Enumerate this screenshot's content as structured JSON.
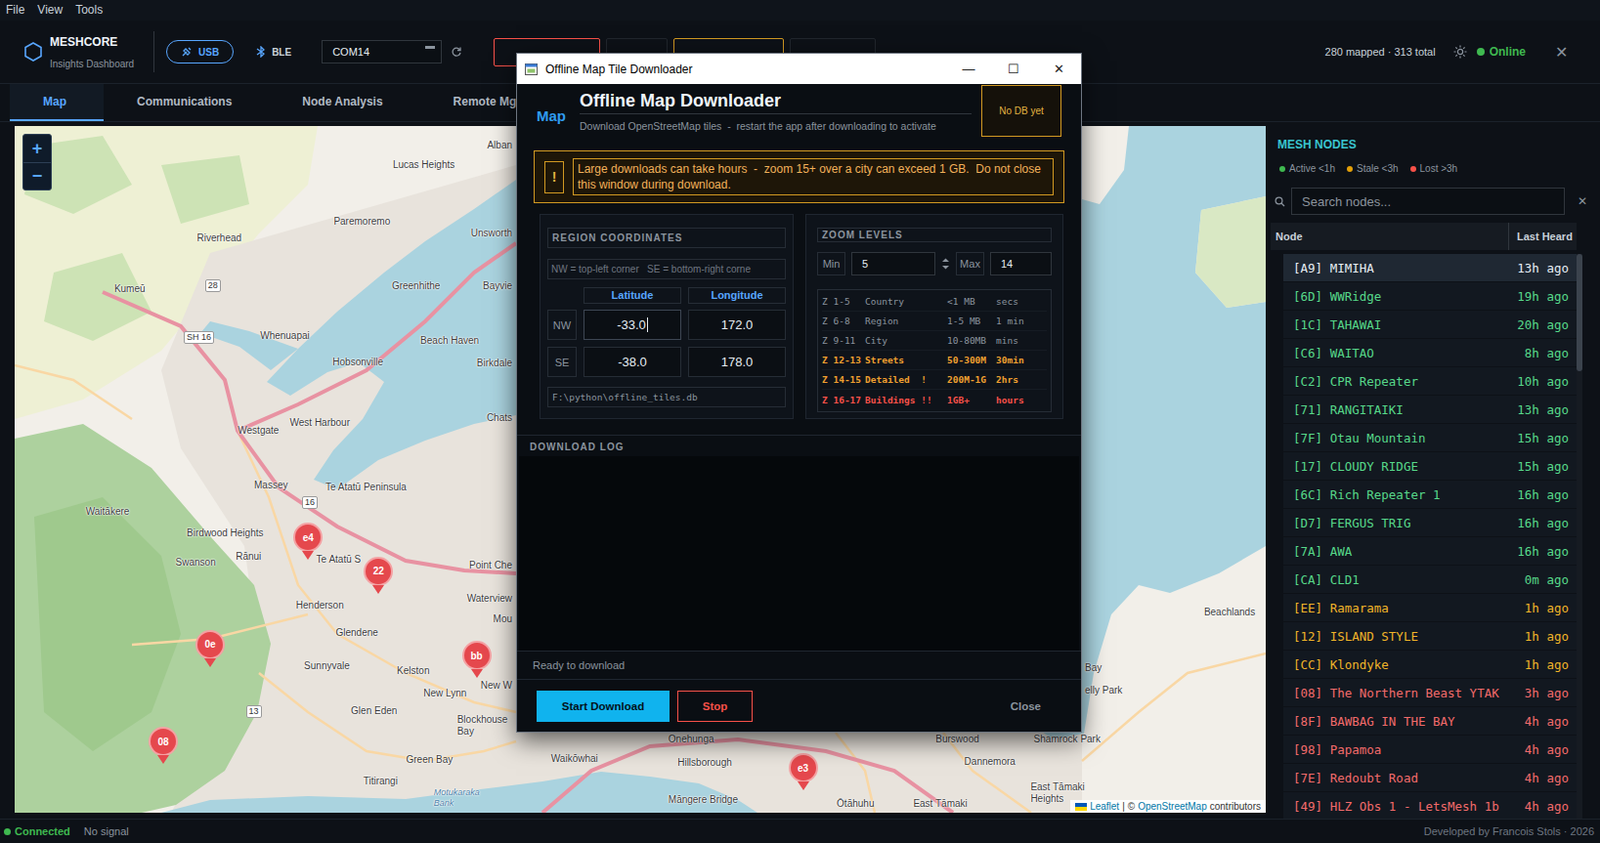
{
  "menu": [
    {
      "label": "File"
    },
    {
      "label": "View"
    },
    {
      "label": "Tools"
    }
  ],
  "header": {
    "logo": {
      "title": "MESHCORE",
      "subtitle": "Insights Dashboard"
    },
    "connection": [
      {
        "label": "USB",
        "selected": true
      },
      {
        "label": "BLE",
        "selected": false
      }
    ],
    "port": "COM14",
    "stats": "280 mapped · 313 total",
    "status": {
      "label": "Online",
      "online": true
    },
    "close": "✕"
  },
  "tabs": [
    {
      "label": "Map",
      "selected": true
    },
    {
      "label": "Communications",
      "selected": false
    },
    {
      "label": "Node Analysis",
      "selected": false
    },
    {
      "label": "Remote Mgr",
      "selected": false
    }
  ],
  "map": {
    "zoom": [
      {
        "label": "+"
      },
      {
        "label": "−"
      }
    ],
    "labels": [
      {
        "text": "Lucas Heights",
        "kind": "place"
      },
      {
        "text": "Alban",
        "kind": "place"
      },
      {
        "text": "Paremoremo",
        "kind": "place"
      },
      {
        "text": "Riverhead",
        "kind": "place"
      },
      {
        "text": "Unsworth",
        "kind": "place"
      },
      {
        "text": "Kumeū",
        "kind": "place"
      },
      {
        "text": "28",
        "kind": "shield"
      },
      {
        "text": "Greenhithe",
        "kind": "place"
      },
      {
        "text": "Bayvie",
        "kind": "place"
      },
      {
        "text": "SH 16",
        "kind": "shield"
      },
      {
        "text": "Whenuapai",
        "kind": "place"
      },
      {
        "text": "Beach Haven",
        "kind": "place"
      },
      {
        "text": "Hobsonville",
        "kind": "place"
      },
      {
        "text": "Birkdale",
        "kind": "place"
      },
      {
        "text": "West Harbour",
        "kind": "place"
      },
      {
        "text": "Chats",
        "kind": "place"
      },
      {
        "text": "Westgate",
        "kind": "place"
      },
      {
        "text": "Massey",
        "kind": "place"
      },
      {
        "text": "Te Atatū Peninsula",
        "kind": "place"
      },
      {
        "text": "16",
        "kind": "shield"
      },
      {
        "text": "Waitākere",
        "kind": "place"
      },
      {
        "text": "Birdwood Heights",
        "kind": "place"
      },
      {
        "text": "Swanson",
        "kind": "place"
      },
      {
        "text": "Rānui",
        "kind": "place"
      },
      {
        "text": "Te Atatū S",
        "kind": "place"
      },
      {
        "text": "Point Che",
        "kind": "place"
      },
      {
        "text": "Henderson",
        "kind": "place"
      },
      {
        "text": "Waterview",
        "kind": "place"
      },
      {
        "text": "Mou",
        "kind": "place"
      },
      {
        "text": "Glendene",
        "kind": "place"
      },
      {
        "text": "Sunnyvale",
        "kind": "place"
      },
      {
        "text": "Kelston",
        "kind": "place"
      },
      {
        "text": "New W",
        "kind": "place"
      },
      {
        "text": "New Lynn",
        "kind": "place"
      },
      {
        "text": "13",
        "kind": "shield"
      },
      {
        "text": "Glen Eden",
        "kind": "place"
      },
      {
        "text": "Blockhouse Bay",
        "kind": "place"
      },
      {
        "text": "Green Bay",
        "kind": "place"
      },
      {
        "text": "Waikōwhai",
        "kind": "place"
      },
      {
        "text": "Titirangi",
        "kind": "place"
      },
      {
        "text": "Onehunga",
        "kind": "place"
      },
      {
        "text": "Hillsborough",
        "kind": "place"
      },
      {
        "text": "Motukaraka Bank",
        "kind": "water"
      },
      {
        "text": "Māngere Bridge",
        "kind": "place"
      },
      {
        "text": "Ōtāhuhu",
        "kind": "place"
      },
      {
        "text": "Burswood",
        "kind": "place"
      },
      {
        "text": "Dannemora",
        "kind": "place"
      },
      {
        "text": "Shamrock Park",
        "kind": "place"
      },
      {
        "text": "East Tāmaki",
        "kind": "place"
      },
      {
        "text": "East Tāmaki Heights",
        "kind": "place"
      },
      {
        "text": "Bay",
        "kind": "place"
      },
      {
        "text": "elly Park",
        "kind": "place"
      },
      {
        "text": "Beachlands",
        "kind": "place"
      }
    ],
    "pins": [
      {
        "label": "e4"
      },
      {
        "label": "22"
      },
      {
        "label": "0e"
      },
      {
        "label": "bb"
      },
      {
        "label": "08"
      },
      {
        "label": "e3"
      }
    ],
    "attribution": {
      "leaflet": "Leaflet",
      "separator": "|",
      "copyright": "©",
      "osm": "OpenStreetMap",
      "contributors": "contributors"
    }
  },
  "sidebar": {
    "title": "MESH NODES",
    "legend": [
      {
        "label": "Active <1h",
        "color": "#3fb950"
      },
      {
        "label": "Stale <3h",
        "color": "#e3a008"
      },
      {
        "label": "Lost >3h",
        "color": "#f85149"
      }
    ],
    "search": {
      "placeholder": "Search nodes...",
      "clear": "✕"
    },
    "columns": [
      "Node",
      "Last Heard"
    ],
    "nodes": [
      {
        "name": "[A9] MIMIHA",
        "last": "13h ago",
        "color": "#e6edf3",
        "selected": true
      },
      {
        "name": "[6D] WWRidge",
        "last": "19h ago",
        "color": "#57d98a",
        "selected": false
      },
      {
        "name": "[1C] TAHAWAI",
        "last": "20h ago",
        "color": "#57d98a",
        "selected": false
      },
      {
        "name": "[C6] WAITAO",
        "last": "8h ago",
        "color": "#57d98a",
        "selected": false
      },
      {
        "name": "[C2] CPR Repeater",
        "last": "10h ago",
        "color": "#57d98a",
        "selected": false
      },
      {
        "name": "[71] RANGITAIKI",
        "last": "13h ago",
        "color": "#57d98a",
        "selected": false
      },
      {
        "name": "[7F] Otau Mountain",
        "last": "15h ago",
        "color": "#57d98a",
        "selected": false
      },
      {
        "name": "[17] CLOUDY RIDGE",
        "last": "15h ago",
        "color": "#57d98a",
        "selected": false
      },
      {
        "name": "[6C] Rich Repeater 1",
        "last": "16h ago",
        "color": "#57d98a",
        "selected": false
      },
      {
        "name": "[D7] FERGUS TRIG",
        "last": "16h ago",
        "color": "#57d98a",
        "selected": false
      },
      {
        "name": "[7A] AWA",
        "last": "16h ago",
        "color": "#57d98a",
        "selected": false
      },
      {
        "name": "[CA] CLD1",
        "last": "0m ago",
        "color": "#57d98a",
        "selected": false
      },
      {
        "name": "[EE] Ramarama",
        "last": "1h ago",
        "color": "#f0b429",
        "selected": false
      },
      {
        "name": "[12] ISLAND STYLE",
        "last": "1h ago",
        "color": "#f0b429",
        "selected": false
      },
      {
        "name": "[CC] Klondyke",
        "last": "1h ago",
        "color": "#f0b429",
        "selected": false
      },
      {
        "name": "[08] The Northern Beast YTAK",
        "last": "3h ago",
        "color": "#f26b6b",
        "selected": false
      },
      {
        "name": "[8F] BAWBAG IN THE BAY",
        "last": "4h ago",
        "color": "#f26b6b",
        "selected": false
      },
      {
        "name": "[98] Papamoa",
        "last": "4h ago",
        "color": "#f26b6b",
        "selected": false
      },
      {
        "name": "[7E] Redoubt Road",
        "last": "4h ago",
        "color": "#f26b6b",
        "selected": false
      },
      {
        "name": "[49] HLZ Obs 1 - LetsMesh 1b",
        "last": "4h ago",
        "color": "#f26b6b",
        "selected": false
      }
    ]
  },
  "dialog": {
    "title": "Offline Map Tile Downloader",
    "controls": [
      "—",
      "☐",
      "✕"
    ],
    "brand": "Map",
    "heading": "Offline Map Downloader",
    "subtitle": "Download OpenStreetMap tiles  -  restart the app after downloading to activate",
    "badge": "No DB yet",
    "warning": {
      "icon": "!",
      "text": "Large downloads can take hours  -  zoom 15+ over a city can exceed 1 GB.  Do not close this window during download."
    },
    "region": {
      "title": "REGION COORDINATES",
      "hint": "NW = top-left corner   SE = bottom-right corne",
      "columns": [
        "Latitude",
        "Longitude"
      ],
      "rows": [
        {
          "label": "NW",
          "lat": "-33.0",
          "lon": "172.0",
          "focused": true
        },
        {
          "label": "SE",
          "lat": "-38.0",
          "lon": "178.0",
          "focused": false
        }
      ],
      "path": "F:\\python\\offline_tiles.db"
    },
    "zoom": {
      "title": "ZOOM LEVELS",
      "min_label": "Min",
      "min": "5",
      "max_label": "Max",
      "max": "14",
      "levels": [
        {
          "range": "Z 1-5",
          "name": "Country",
          "size": "<1 MB",
          "time": "secs",
          "color": "#8b949e"
        },
        {
          "range": "Z 6-8",
          "name": "Region",
          "size": "1-5 MB",
          "time": "1 min",
          "color": "#8b949e"
        },
        {
          "range": "Z 9-11",
          "name": "City",
          "size": "10-80MB",
          "time": "mins",
          "color": "#8b949e"
        },
        {
          "range": "Z 12-13",
          "name": "Streets",
          "size": "50-300M",
          "time": "30min",
          "color": "#f0a030"
        },
        {
          "range": "Z 14-15",
          "name": "Detailed  !",
          "size": "200M-1G",
          "time": "2hrs",
          "color": "#f0a030"
        },
        {
          "range": "Z 16-17",
          "name": "Buildings !!",
          "size": "1GB+",
          "time": "hours",
          "color": "#f85149"
        }
      ]
    },
    "log": {
      "title": "DOWNLOAD LOG"
    },
    "status": "Ready to download",
    "buttons": [
      {
        "label": "Start Download",
        "kind": "primary"
      },
      {
        "label": "Stop",
        "kind": "danger"
      },
      {
        "label": "Close",
        "kind": "plain"
      }
    ]
  },
  "status_bar": {
    "connection": {
      "label": "Connected",
      "connected": true
    },
    "signal": "No signal",
    "credit": "Developed by Francois Stols · 2026"
  }
}
